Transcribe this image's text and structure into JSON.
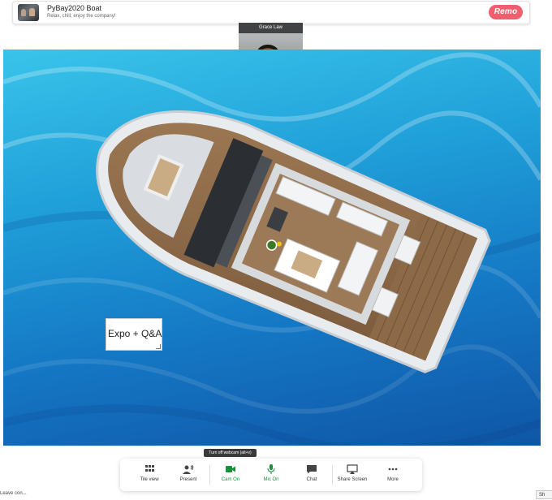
{
  "event": {
    "title": "PyBay2020 Boat",
    "subtitle": "Relax, chill, enjoy the company!",
    "logo_text": "Remo"
  },
  "video": {
    "participant_name": "Grace Law"
  },
  "floor": {
    "room_label": "Expo + Q&A"
  },
  "tooltip": "Turn off webcam (alt+v)",
  "toolbar": {
    "tile_view": "Tile view",
    "present": "Present",
    "cam": "Cam On",
    "mic": "Mic On",
    "chat": "Chat",
    "share": "Share Screen",
    "more": "More"
  },
  "bottom": {
    "left_text": "Leave con...",
    "right_text": "Sh"
  },
  "icons": {
    "tile_view": "grid-icon",
    "present": "present-icon",
    "cam": "camera-icon",
    "mic": "microphone-icon",
    "chat": "chat-icon",
    "share": "share-screen-icon",
    "more": "more-dots-icon"
  },
  "colors": {
    "accent_green": "#1b8f3a",
    "brand": "#f15f6f",
    "ocean": "#1f9ed8"
  }
}
